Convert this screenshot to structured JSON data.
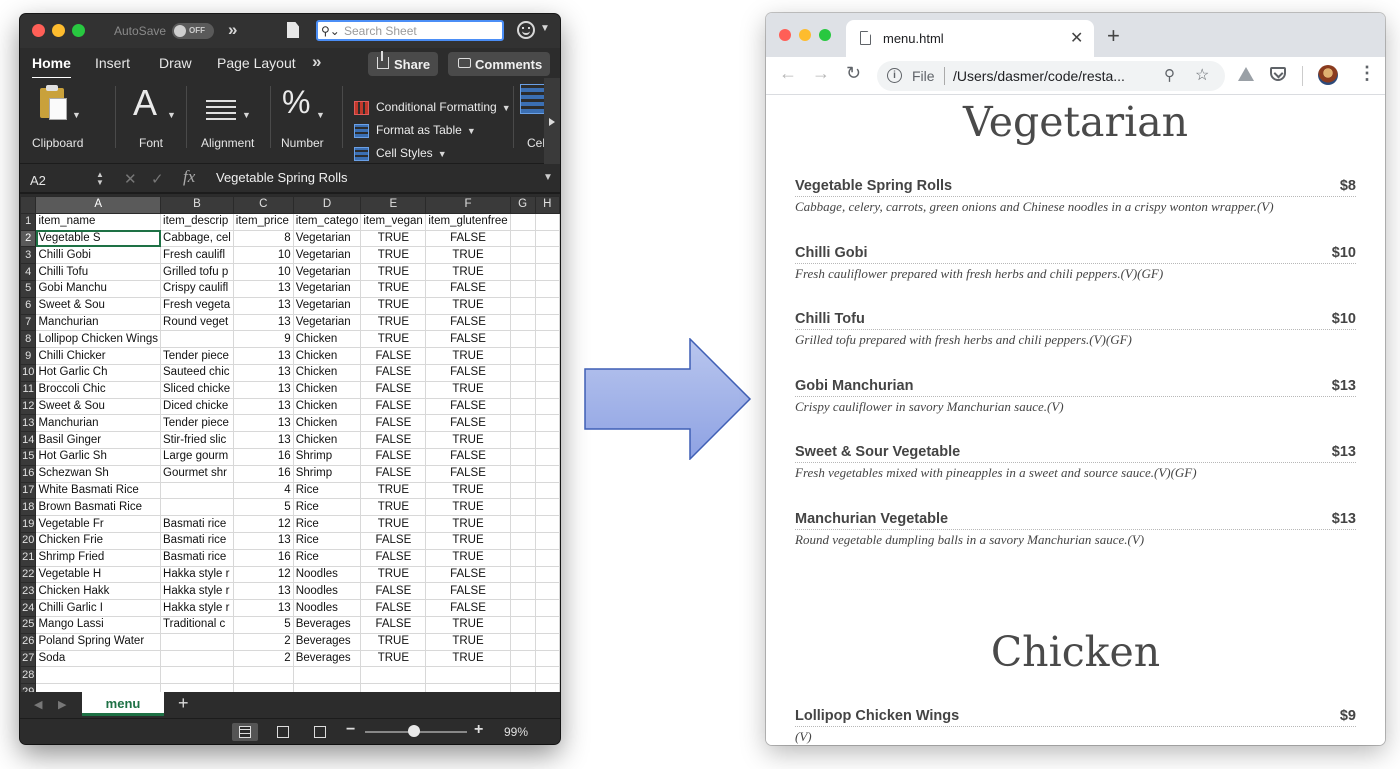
{
  "excel": {
    "autosave_label": "AutoSave",
    "autosave_state": "OFF",
    "search_placeholder": "Search Sheet",
    "tabs": [
      "Home",
      "Insert",
      "Draw",
      "Page Layout"
    ],
    "share_label": "Share",
    "comments_label": "Comments",
    "ribbon": {
      "clipboard": "Clipboard",
      "font_glyph": "A",
      "font": "Font",
      "alignment": "Alignment",
      "number_glyph": "%",
      "number": "Number",
      "conditional_formatting": "Conditional Formatting",
      "format_as_table": "Format as Table",
      "cell_styles": "Cell Styles",
      "cells": "Cel"
    },
    "name_box": "A2",
    "formula_value": "Vegetable Spring Rolls",
    "column_letters": [
      "A",
      "B",
      "C",
      "D",
      "E",
      "F",
      "G",
      "H"
    ],
    "rows": [
      [
        "item_name",
        "item_descrip",
        "item_price",
        "item_catego",
        "item_vegan",
        "item_glutenfree",
        "",
        ""
      ],
      [
        "Vegetable S",
        "Cabbage, cel",
        "8",
        "Vegetarian",
        "TRUE",
        "FALSE",
        "",
        ""
      ],
      [
        "Chilli Gobi",
        "Fresh caulifl",
        "10",
        "Vegetarian",
        "TRUE",
        "TRUE",
        "",
        ""
      ],
      [
        "Chilli Tofu",
        "Grilled tofu p",
        "10",
        "Vegetarian",
        "TRUE",
        "TRUE",
        "",
        ""
      ],
      [
        "Gobi Manchu",
        "Crispy caulifl",
        "13",
        "Vegetarian",
        "TRUE",
        "FALSE",
        "",
        ""
      ],
      [
        "Sweet & Sou",
        "Fresh vegeta",
        "13",
        "Vegetarian",
        "TRUE",
        "TRUE",
        "",
        ""
      ],
      [
        "Manchurian",
        "Round veget",
        "13",
        "Vegetarian",
        "TRUE",
        "FALSE",
        "",
        ""
      ],
      [
        "Lollipop Chicken Wings",
        "",
        "9",
        "Chicken",
        "TRUE",
        "FALSE",
        "",
        ""
      ],
      [
        "Chilli Chicker",
        "Tender piece",
        "13",
        "Chicken",
        "FALSE",
        "TRUE",
        "",
        ""
      ],
      [
        "Hot Garlic Ch",
        "Sauteed chic",
        "13",
        "Chicken",
        "FALSE",
        "FALSE",
        "",
        ""
      ],
      [
        "Broccoli Chic",
        "Sliced chicke",
        "13",
        "Chicken",
        "FALSE",
        "TRUE",
        "",
        ""
      ],
      [
        "Sweet & Sou",
        "Diced chicke",
        "13",
        "Chicken",
        "FALSE",
        "FALSE",
        "",
        ""
      ],
      [
        "Manchurian",
        "Tender piece",
        "13",
        "Chicken",
        "FALSE",
        "FALSE",
        "",
        ""
      ],
      [
        "Basil Ginger",
        "Stir-fried slic",
        "13",
        "Chicken",
        "FALSE",
        "TRUE",
        "",
        ""
      ],
      [
        "Hot Garlic Sh",
        "Large gourm",
        "16",
        "Shrimp",
        "FALSE",
        "FALSE",
        "",
        ""
      ],
      [
        "Schezwan Sh",
        "Gourmet shr",
        "16",
        "Shrimp",
        "FALSE",
        "FALSE",
        "",
        ""
      ],
      [
        "White Basmati Rice",
        "",
        "4",
        "Rice",
        "TRUE",
        "TRUE",
        "",
        ""
      ],
      [
        "Brown Basmati Rice",
        "",
        "5",
        "Rice",
        "TRUE",
        "TRUE",
        "",
        ""
      ],
      [
        "Vegetable Fr",
        "Basmati rice",
        "12",
        "Rice",
        "TRUE",
        "TRUE",
        "",
        ""
      ],
      [
        "Chicken Frie",
        "Basmati rice",
        "13",
        "Rice",
        "FALSE",
        "TRUE",
        "",
        ""
      ],
      [
        "Shrimp Fried",
        "Basmati rice",
        "16",
        "Rice",
        "FALSE",
        "TRUE",
        "",
        ""
      ],
      [
        "Vegetable H",
        "Hakka style r",
        "12",
        "Noodles",
        "TRUE",
        "FALSE",
        "",
        ""
      ],
      [
        "Chicken Hakk",
        "Hakka style r",
        "13",
        "Noodles",
        "FALSE",
        "FALSE",
        "",
        ""
      ],
      [
        "Chilli Garlic I",
        "Hakka style r",
        "13",
        "Noodles",
        "FALSE",
        "FALSE",
        "",
        ""
      ],
      [
        "Mango Lassi",
        "Traditional c",
        "5",
        "Beverages",
        "FALSE",
        "TRUE",
        "",
        ""
      ],
      [
        "Poland Spring Water",
        "",
        "2",
        "Beverages",
        "TRUE",
        "TRUE",
        "",
        ""
      ],
      [
        "Soda",
        "",
        "2",
        "Beverages",
        "TRUE",
        "TRUE",
        "",
        ""
      ],
      [
        "",
        "",
        "",
        "",
        "",
        "",
        "",
        ""
      ],
      [
        "",
        "",
        "",
        "",
        "",
        "",
        "",
        ""
      ]
    ],
    "sheet_tab": "menu",
    "zoom": "99%"
  },
  "browser": {
    "tab_title": "menu.html",
    "url_scheme": "File",
    "url": "/Users/dasmer/code/resta...",
    "categories": [
      {
        "title": "Vegetarian",
        "items": [
          {
            "name": "Vegetable Spring Rolls",
            "price": "$8",
            "desc": "Cabbage, celery, carrots, green onions and Chinese noodles in a crispy wonton wrapper.(V)"
          },
          {
            "name": "Chilli Gobi",
            "price": "$10",
            "desc": "Fresh cauliflower prepared with fresh herbs and chili peppers.(V)(GF)"
          },
          {
            "name": "Chilli Tofu",
            "price": "$10",
            "desc": "Grilled tofu prepared with fresh herbs and chili peppers.(V)(GF)"
          },
          {
            "name": "Gobi Manchurian",
            "price": "$13",
            "desc": "Crispy cauliflower in savory Manchurian sauce.(V)"
          },
          {
            "name": "Sweet & Sour Vegetable",
            "price": "$13",
            "desc": "Fresh vegetables mixed with pineapples in a sweet and source sauce.(V)(GF)"
          },
          {
            "name": "Manchurian Vegetable",
            "price": "$13",
            "desc": "Round vegetable dumpling balls in a savory Manchurian sauce.(V)"
          }
        ]
      },
      {
        "title": "Chicken",
        "items": [
          {
            "name": "Lollipop Chicken Wings",
            "price": "$9",
            "desc": "(V)"
          }
        ]
      }
    ]
  },
  "colors": {
    "excel_green": "#1e7145",
    "arrow_fill_start": "#b9c6ee",
    "arrow_fill_end": "#8ea2e3",
    "arrow_stroke": "#3f5fb5"
  }
}
